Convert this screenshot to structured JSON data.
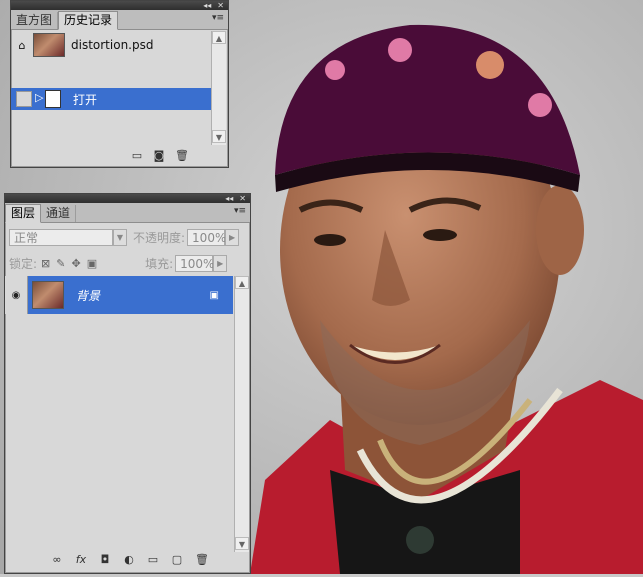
{
  "history_panel": {
    "tabs": [
      "直方图",
      "历史记录"
    ],
    "active_tab": 1,
    "document_name": "distortion.psd",
    "states": [
      {
        "label": "打开"
      }
    ],
    "title_buttons": {
      "collapse": "◂◂",
      "close": "✕"
    },
    "menu_icon": "panel-menu-icon",
    "footer_icons": [
      "new-document-from-state-icon",
      "snapshot-icon",
      "trash-icon"
    ]
  },
  "layers_panel": {
    "tabs": [
      "图层",
      "通道"
    ],
    "active_tab": 0,
    "blend_mode": "正常",
    "opacity_label": "不透明度:",
    "opacity_value": "100%",
    "lock_label": "锁定:",
    "fill_label": "填充:",
    "fill_value": "100%",
    "layers": [
      {
        "name": "背景",
        "visible": true,
        "locked": true
      }
    ],
    "footer_icons": [
      "link-layers-icon",
      "fx-icon",
      "mask-icon",
      "adjustment-icon",
      "group-icon",
      "new-layer-icon",
      "trash-icon"
    ],
    "fx_label": "fx"
  },
  "colors": {
    "selection": "#3a6fcf",
    "panel_bg": "#d8d8d8",
    "titlebar": "#333333"
  }
}
